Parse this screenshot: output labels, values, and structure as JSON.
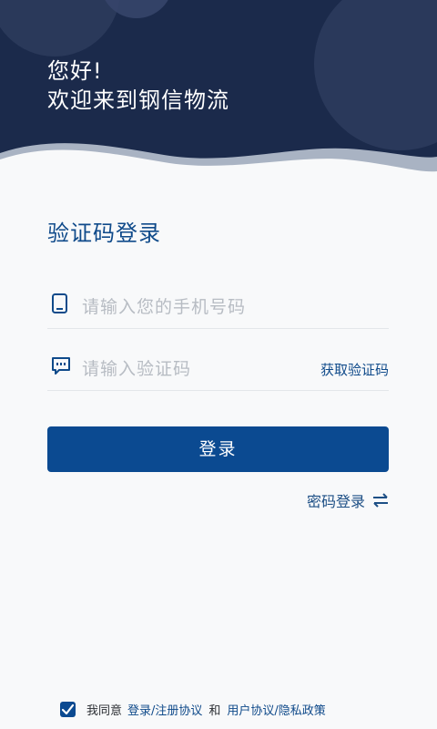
{
  "header": {
    "greeting_line1": "您好!",
    "greeting_line2": "欢迎来到钢信物流"
  },
  "login": {
    "title": "验证码登录",
    "phone_placeholder": "请输入您的手机号码",
    "code_placeholder": "请输入验证码",
    "get_code_label": "获取验证码",
    "button_label": "登录",
    "switch_label": "密码登录"
  },
  "agreement": {
    "checked": true,
    "prefix": "我同意",
    "link1": "登录/注册协议",
    "and": "和",
    "link2": "用户协议/隐私政策"
  },
  "colors": {
    "header_bg": "#1b2a4b",
    "accent": "#0b4a91",
    "link": "#0f4a8a"
  },
  "icons": [
    "phone-icon",
    "message-icon",
    "swap-icon",
    "check-icon"
  ]
}
